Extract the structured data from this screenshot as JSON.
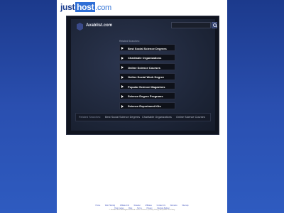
{
  "header": {
    "logo_main": "just",
    "logo_box": "host",
    "logo_suffix": ".com"
  },
  "site": {
    "title": "Avablist.com"
  },
  "search": {
    "placeholder": "",
    "button_icon": "search-icon"
  },
  "related_label": "Related Searches:",
  "links": [
    "Best Social Science Degrees",
    "Charitable Organizations",
    "Online Science Courses",
    "Online Social Work Degree",
    "Popular Science Magazines",
    "Science Degree Programs",
    "Science Experiment Kits"
  ],
  "bottom_bar": {
    "label": "Related Searches:",
    "items": [
      "Best Social Science Degrees",
      "Charitable Organizations",
      "Online Science Courses"
    ]
  },
  "footer": {
    "links": [
      "Home",
      "Web Hosting",
      "Affiliate Info",
      "Reseller",
      "Affiliates",
      "Contact Us",
      "Domains",
      "Sitemap",
      "Help Center",
      "Blog",
      "Terms",
      "Privacy",
      "Website Builder"
    ],
    "copyright": "© JustHost 2015. All Rights Reserved. Terms of Service | Privacy Policy | Acceptable Use Policy"
  },
  "colors": {
    "background": "#2a4fb0",
    "panel": "#10141f",
    "logo_box": "#2f6fd6"
  }
}
